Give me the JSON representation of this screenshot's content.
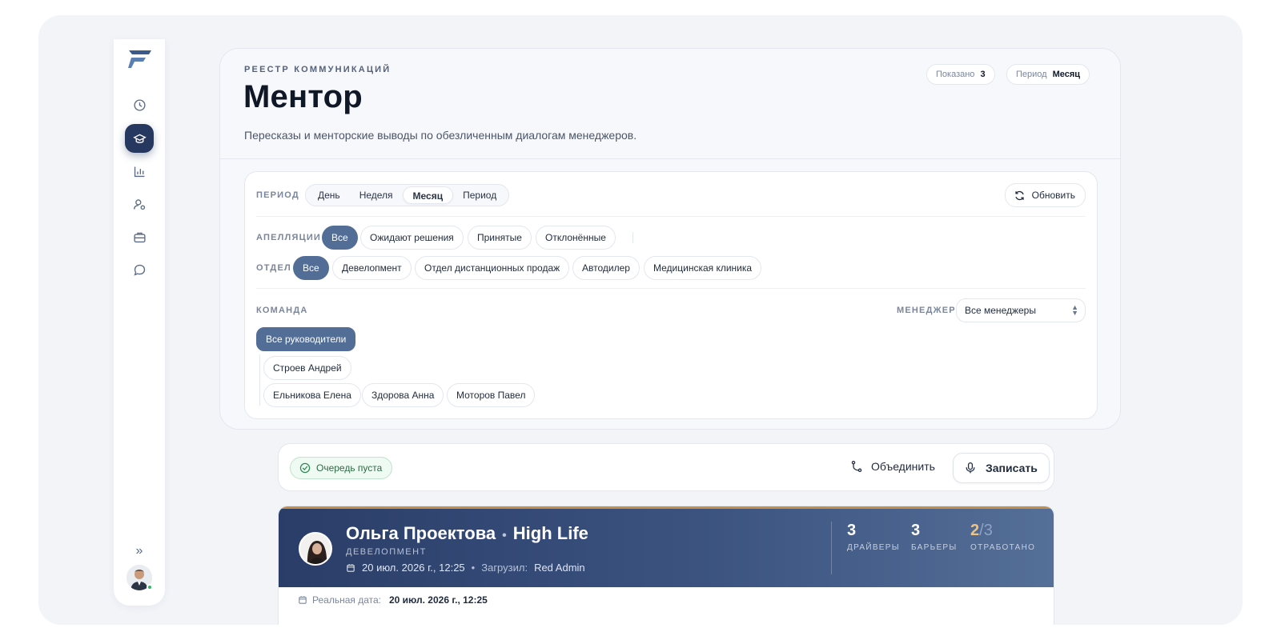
{
  "header": {
    "eyebrow": "РЕЕСТР КОММУНИКАЦИЙ",
    "title": "Ментор",
    "subtitle": "Пересказы и менторские выводы по обезличенным диалогам менеджеров.",
    "shown_label": "Показано",
    "shown_value": "3",
    "period_label": "Период",
    "period_value": "Месяц"
  },
  "filters": {
    "period_label": "ПЕРИОД",
    "period_options": [
      "День",
      "Неделя",
      "Месяц",
      "Период"
    ],
    "period_selected": "Месяц",
    "refresh_label": "Обновить",
    "appeals_label": "АПЕЛЛЯЦИИ",
    "appeals_options": [
      "Все",
      "Ожидают решения",
      "Принятые",
      "Отклонённые"
    ],
    "dept_label": "ОТДЕЛ",
    "dept_options": [
      "Все",
      "Девелопмент",
      "Отдел дистанционных продаж",
      "Автодилер",
      "Медицинская клиника"
    ],
    "team_label": "КОМАНДА",
    "manager_label": "МЕНЕДЖЕР",
    "manager_value": "Все менеджеры",
    "team_all": "Все руководители",
    "team_lead": "Строев Андрей",
    "team_members": [
      "Ельникова Елена",
      "Здорова Анна",
      "Моторов Павел"
    ]
  },
  "queue": {
    "status": "Очередь пуста",
    "merge_label": "Объединить",
    "record_label": "Записать"
  },
  "dialog": {
    "name": "Ольга Проектова",
    "company": "High Life",
    "department": "ДЕВЕЛОПМЕНТ",
    "datetime": "20 июл. 2026 г., 12:25",
    "uploaded_label": "Загрузил:",
    "uploaded_by": "Red Admin",
    "drivers_value": "3",
    "drivers_label": "ДРАЙВЕРЫ",
    "barriers_value": "3",
    "barriers_label": "БАРЬЕРЫ",
    "worked_done": "2",
    "worked_total": "3",
    "worked_label": "ОТРАБОТАНО",
    "real_date_label": "Реальная дата:",
    "real_date_value": "20 июл. 2026 г., 12:25"
  },
  "colors": {
    "accent": "#26385f",
    "pill_active": "#536e96",
    "success": "#2fb866",
    "gold": "#c58d4a"
  }
}
